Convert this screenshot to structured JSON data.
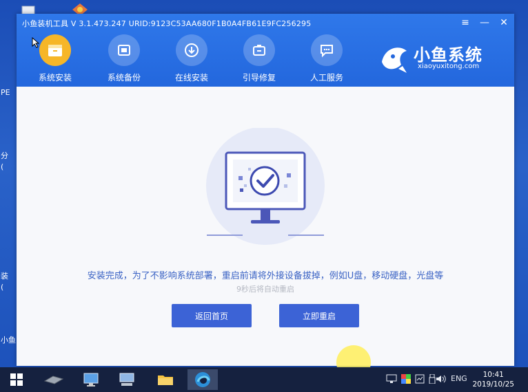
{
  "window": {
    "title": "小鱼装机工具 V 3.1.473.247 URID:9123C53AA680F1B0A4FB61E9FC256295",
    "minimize_label": "—",
    "menu_label": "≡",
    "close_label": "✕"
  },
  "nav": [
    {
      "label": "系统安装",
      "icon": "system-install-icon",
      "active": true
    },
    {
      "label": "系统备份",
      "icon": "system-backup-icon"
    },
    {
      "label": "在线安装",
      "icon": "online-install-icon"
    },
    {
      "label": "引导修复",
      "icon": "boot-repair-icon"
    },
    {
      "label": "人工服务",
      "icon": "chat-icon"
    }
  ],
  "brand": {
    "name": "小鱼系统",
    "url": "xiaoyuxitong.com"
  },
  "main": {
    "message": "安装完成，为了不影响系统部署，重启前请将外接设备拔掉，例如U盘，移动硬盘，光盘等",
    "countdown": "9秒后将自动重启",
    "back_button": "返回首页",
    "restart_button": "立即重启"
  },
  "desktop": {
    "labels": [
      "PE",
      "分",
      "(",
      "装",
      "(",
      "小鱼"
    ]
  },
  "taskbar": {
    "language": "ENG",
    "time": "10:41",
    "date": "2019/10/25"
  },
  "colors": {
    "accent": "#2367dd",
    "button": "#3c63d6",
    "nav_active": "#f6b628",
    "taskbar": "#15213f"
  }
}
